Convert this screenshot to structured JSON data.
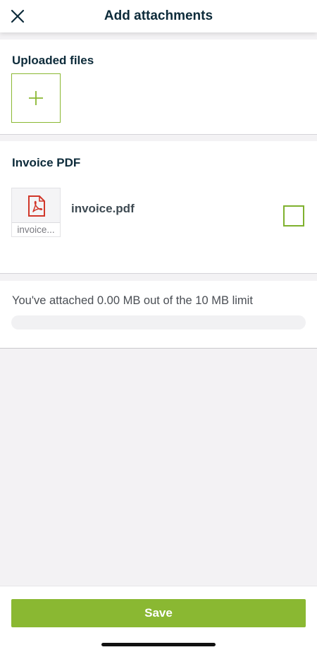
{
  "header": {
    "title": "Add attachments",
    "close_icon": "close-icon"
  },
  "uploaded": {
    "title": "Uploaded files",
    "add_icon": "plus-icon"
  },
  "invoice": {
    "title": "Invoice PDF",
    "file": {
      "name": "invoice.pdf",
      "thumb_caption": "invoice...",
      "icon": "pdf-icon",
      "selected": false
    }
  },
  "limit": {
    "text": "You've attached 0.00 MB out of the 10 MB limit",
    "used_mb": 0.0,
    "limit_mb": 10,
    "progress_fraction": 0
  },
  "footer": {
    "save_label": "Save"
  },
  "colors": {
    "accent": "#8ab832",
    "title_text": "#0d2b3a",
    "pdf_red": "#d1372a",
    "background": "#f3f2f4"
  }
}
